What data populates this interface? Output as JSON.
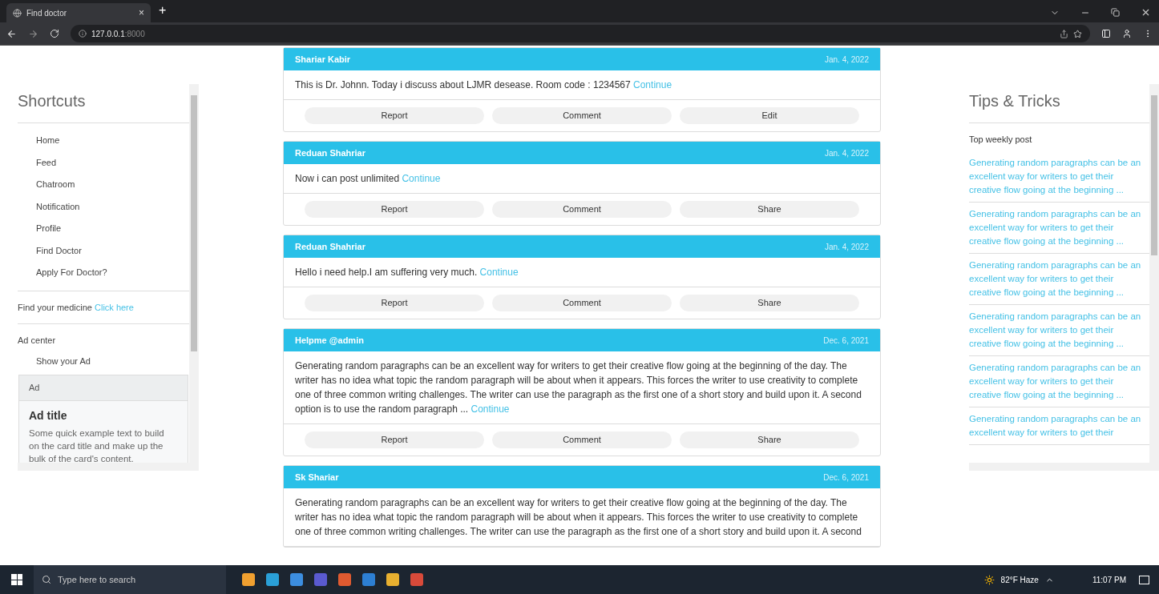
{
  "browser": {
    "tab_title": "Find doctor",
    "tab_close": "×",
    "new_tab": "+",
    "url_host": "127.0.0.1",
    "url_port": ":8000"
  },
  "shortcuts": {
    "title": "Shortcuts",
    "items": [
      {
        "label": "Home"
      },
      {
        "label": "Feed"
      },
      {
        "label": "Chatroom"
      },
      {
        "label": "Notification"
      },
      {
        "label": "Profile"
      },
      {
        "label": "Find Doctor"
      },
      {
        "label": "Apply For Doctor?"
      }
    ],
    "medicine_text": "Find your medicine",
    "medicine_link": "Click here",
    "ad_center": "Ad center",
    "ad_link": "Show your Ad",
    "ad_card": {
      "header": "Ad",
      "title": "Ad title",
      "text": "Some quick example text to build on the card title and make up the bulk of the card's content."
    }
  },
  "posts": [
    {
      "author": "Shariar Kabir",
      "date": "Jan. 4, 2022",
      "body": "This is Dr. Johnn. Today i discuss about LJMR desease. Room code : 1234567",
      "link": "Continue",
      "actions": [
        "Report",
        "Comment",
        "Edit"
      ]
    },
    {
      "author": "Reduan Shahriar",
      "date": "Jan. 4, 2022",
      "body": "Now i can post unlimited",
      "link": "Continue",
      "actions": [
        "Report",
        "Comment",
        "Share"
      ]
    },
    {
      "author": "Reduan Shahriar",
      "date": "Jan. 4, 2022",
      "body": "Hello i need help.I am suffering very much.",
      "link": "Continue",
      "actions": [
        "Report",
        "Comment",
        "Share"
      ]
    },
    {
      "author": "Helpme @admin",
      "date": "Dec. 6, 2021",
      "body": "Generating random paragraphs can be an excellent way for writers to get their creative flow going at the beginning of the day. The writer has no idea what topic the random paragraph will be about when it appears. This forces the writer to use creativity to complete one of three common writing challenges. The writer can use the paragraph as the first one of a short story and build upon it. A second option is to use the random paragraph ...",
      "link": "Continue",
      "actions": [
        "Report",
        "Comment",
        "Share"
      ]
    },
    {
      "author": "Sk Shariar",
      "date": "Dec. 6, 2021",
      "body": "Generating random paragraphs can be an excellent way for writers to get their creative flow going at the beginning of the day. The writer has no idea what topic the random paragraph will be about when it appears. This forces the writer to use creativity to complete one of three common writing challenges. The writer can use the paragraph as the first one of a short story and build upon it. A second"
    }
  ],
  "tips": {
    "title": "Tips & Tricks",
    "subtitle": "Top weekly post",
    "items": [
      {
        "text": "Generating random paragraphs can be an excellent way for writers to get their creative flow going at the beginning ..."
      },
      {
        "text": "Generating random paragraphs can be an excellent way for writers to get their creative flow going at the beginning ..."
      },
      {
        "text": "Generating random paragraphs can be an excellent way for writers to get their creative flow going at the beginning ..."
      },
      {
        "text": "Generating random paragraphs can be an excellent way for writers to get their creative flow going at the beginning ..."
      },
      {
        "text": "Generating random paragraphs can be an excellent way for writers to get their creative flow going at the beginning ..."
      },
      {
        "text": "Generating random paragraphs can be an excellent way for writers to get their"
      }
    ]
  },
  "taskbar": {
    "search_placeholder": "Type here to search",
    "weather": "82°F Haze",
    "time": "11:07 PM"
  }
}
